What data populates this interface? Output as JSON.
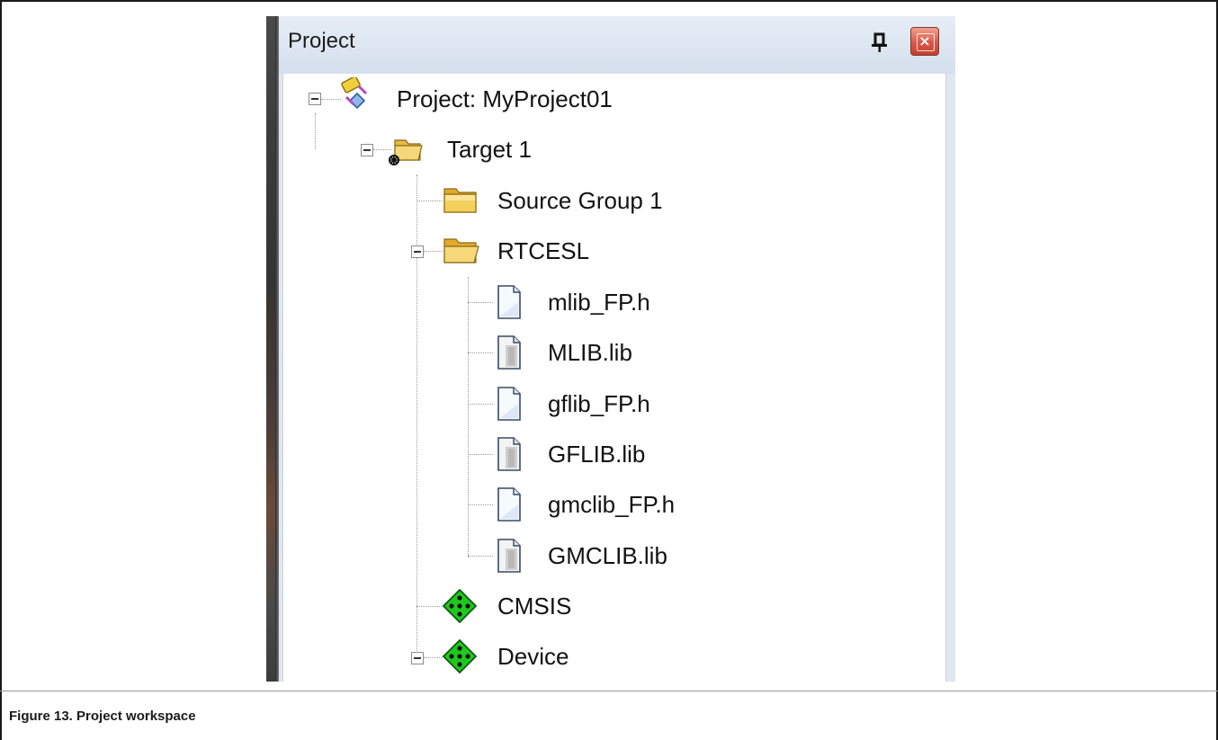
{
  "pane": {
    "title": "Project",
    "pin_glyph": "q",
    "close_glyph": "×"
  },
  "tree": {
    "root": "Project: MyProject01",
    "target": "Target 1",
    "source_group": "Source Group 1",
    "rtcesl": "RTCESL",
    "files": [
      "mlib_FP.h",
      "MLIB.lib",
      "gflib_FP.h",
      "GFLIB.lib",
      "gmclib_FP.h",
      "GMCLIB.lib"
    ],
    "cmsis": "CMSIS",
    "device": "Device"
  },
  "icons": {
    "root": "project-icon",
    "target": "target-folder-icon",
    "folder": "folder-icon",
    "header": "header-file-icon",
    "library": "library-file-icon",
    "component": "software-component-icon"
  },
  "caption": "Figure 13. Project workspace"
}
